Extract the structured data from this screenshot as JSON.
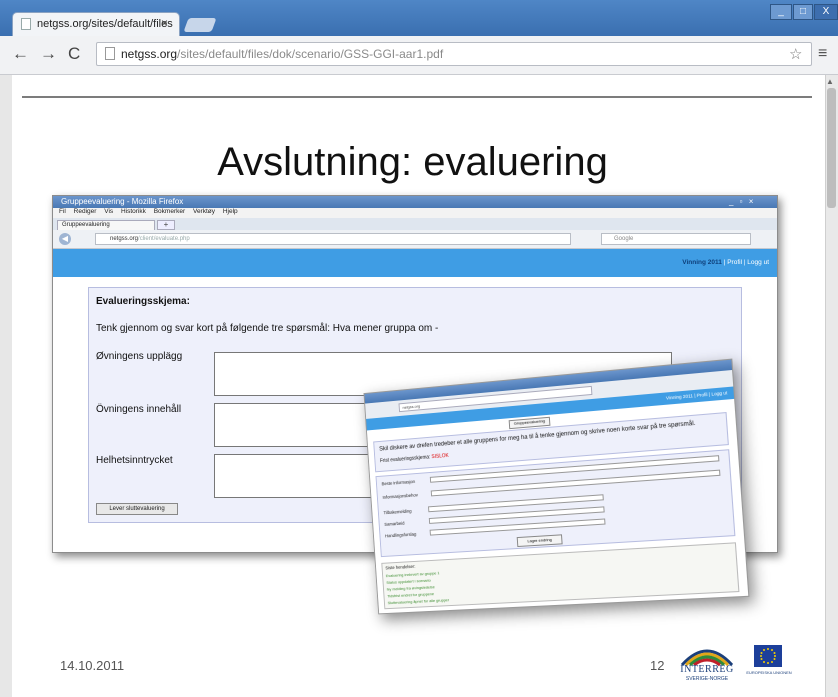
{
  "browser": {
    "tab_title": "netgss.org/sites/default/files",
    "tab_close": "×",
    "url_host": "netgss.org",
    "url_path": "/sites/default/files/dok/scenario/GSS-GGI-aar1.pdf",
    "window_buttons": [
      "_",
      "□",
      "X"
    ]
  },
  "slide": {
    "title": "Avslutning: evaluering",
    "date": "14.10.2011",
    "page_number": "12",
    "logo_text": "INTERREG",
    "logo_subtext": "SVERIGE-NORGE",
    "eu_text": "EUROPEISKA UNIONEN"
  },
  "screenshot1": {
    "window_title": "Gruppeevaluering - Mozilla Firefox",
    "menu": [
      "Fil",
      "Rediger",
      "Vis",
      "Historikk",
      "Bokmerker",
      "Verktøy",
      "Hjelp"
    ],
    "tab": "Gruppeevaluering",
    "url_host": "netgss.org",
    "url_path": "/client/evaluate.php",
    "search_placeholder": "Google",
    "header_links": "Vinning 2011 | Profil | Logg ut",
    "header_user": "Vinning 2011",
    "header_rest": "| Profil | Logg ut",
    "heading": "Evalueringsskjema:",
    "intro": "Tenk gjennom og svar kort på følgende tre spørsmål: Hva mener gruppa om -",
    "fields": [
      "Øvningens upplägg",
      "Övningens innehåll",
      "Helhetsinntrycket"
    ],
    "submit": "Lever sluttevaluering"
  },
  "screenshot2": {
    "text": "Skil diskere av drefen tredeber et alle gruppens for meg ha til å tenke gjennom og skrive noen korte svar på tre spørsmål.",
    "deadline_label": "Frist evalueringsskjema:",
    "deadline_value": "SISLOK",
    "rows": [
      "Beste informasjon",
      "Informasjonsbehov",
      "Tilbakemelding",
      "Samarbeid",
      "Handlingsforslag"
    ],
    "button": "Lagre endring",
    "log_header": "Siste hendelser:",
    "log_lines": [
      "Evaluering innlevert av gruppe 1",
      "Status oppdatert i scenario",
      "Ny melding fra øvingsledelse",
      "Tidsfrist endret for gruppene",
      "Sluttevaluering åpnet for alle grupper"
    ]
  }
}
